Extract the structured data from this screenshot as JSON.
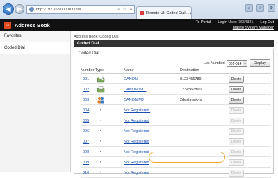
{
  "browser": {
    "url": "http://192.168.000.000/rui/...",
    "tab_title": "Remote UI: Coded Dial:..."
  },
  "header": {
    "app_title": "Address Book",
    "logo_glyph": "⌂",
    "to_portal": "To Portal",
    "login_user": "Login User: 7654321",
    "log_out": "Log Out",
    "mail_to_manager": "Mail to System Manager"
  },
  "sidebar": {
    "items": [
      {
        "label": "Favorites",
        "active": false
      },
      {
        "label": "Coded Dial",
        "active": true
      }
    ]
  },
  "main": {
    "breadcrumb": "Address Book: Coded Dial",
    "section_title": "Coded Dial",
    "panel_title": "Coded Dial",
    "list_number_label": "List Number:",
    "list_number_value": "001-014",
    "display_button": "Display",
    "columns": {
      "number": "Number",
      "type": "Type",
      "name": "Name",
      "destination": "Destination"
    },
    "delete_label": "Delete",
    "rows": [
      {
        "number": "001",
        "type": "fax-icon",
        "name": "CANON",
        "destination": "0123456789",
        "enabled": true
      },
      {
        "number": "002",
        "type": "fax-icon",
        "name": "CANON INC.",
        "destination": "1234567890",
        "enabled": true
      },
      {
        "number": "003",
        "type": "group-icon",
        "name": "CANON MJ",
        "destination": "2destinations",
        "enabled": true
      },
      {
        "number": "004",
        "type": "empty",
        "name": "Not Registered.",
        "destination": "",
        "enabled": false
      },
      {
        "number": "005",
        "type": "empty",
        "name": "Not Registered",
        "destination": "",
        "enabled": false
      },
      {
        "number": "006",
        "type": "empty",
        "name": "Not Registered",
        "destination": "",
        "enabled": false
      },
      {
        "number": "007",
        "type": "empty",
        "name": "Not Registered",
        "destination": "",
        "enabled": false
      },
      {
        "number": "008",
        "type": "empty",
        "name": "Not Registered",
        "destination": "",
        "enabled": false
      },
      {
        "number": "009",
        "type": "empty",
        "name": "Not Registered",
        "destination": "",
        "enabled": false
      },
      {
        "number": "010",
        "type": "empty",
        "name": "Not Registered",
        "destination": "",
        "enabled": false
      }
    ]
  },
  "colors": {
    "highlight": "#f0a830",
    "link": "#1a4fb0",
    "header_bg": "#111111"
  }
}
